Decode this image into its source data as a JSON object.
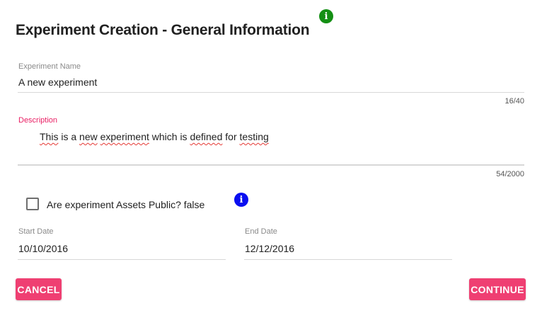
{
  "form": {
    "title": "Experiment Creation - General Information",
    "name": {
      "label": "Experiment Name",
      "value": "A new experiment",
      "counter": "16/40"
    },
    "description": {
      "label": "Description",
      "words": [
        "This",
        " is a ",
        "new",
        " ",
        "experiment",
        " which is ",
        "defined",
        " for ",
        "testing"
      ],
      "counter": "54/2000"
    },
    "assets_public": {
      "label": "Are experiment Assets Public? false",
      "checked": false
    },
    "start_date": {
      "label": "Start Date",
      "value": "10/10/2016"
    },
    "end_date": {
      "label": "End Date",
      "value": "12/12/2016"
    },
    "actions": {
      "cancel": "CANCEL",
      "continue": "CONTINUE"
    },
    "info_icon_glyph": "i"
  },
  "colors": {
    "accent": "#ef3f72",
    "label_active": "#e91e63",
    "info_green": "#148f14",
    "info_blue": "#0a0ef0"
  },
  "icons": [
    "info-icon",
    "checkbox-icon"
  ]
}
